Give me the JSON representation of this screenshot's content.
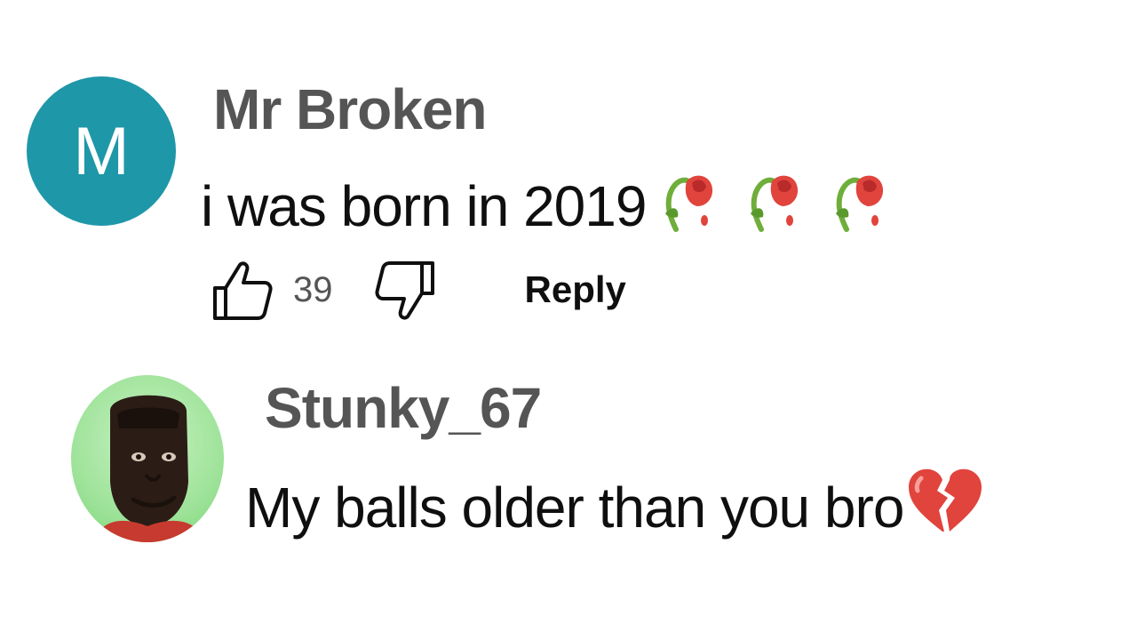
{
  "comments": [
    {
      "avatar_letter": "M",
      "avatar_color": "#1e97a8",
      "author": "Mr Broken",
      "text": "i was born in 2019",
      "emoji": [
        "wilted-rose-icon",
        "wilted-rose-icon",
        "wilted-rose-icon"
      ],
      "like_count": "39",
      "reply_label": "Reply"
    },
    {
      "author": "Stunky_67",
      "text": "My balls older than you bro",
      "emoji": [
        "broken-heart-icon"
      ]
    }
  ]
}
